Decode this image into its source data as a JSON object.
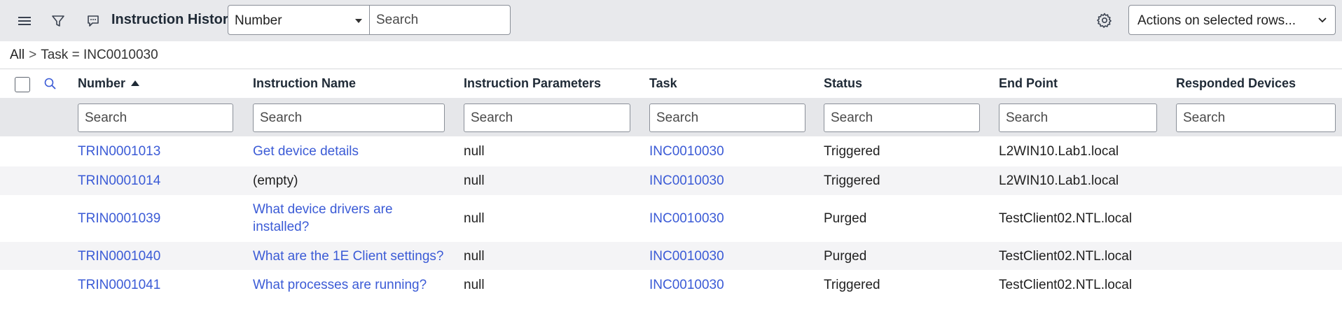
{
  "toolbar": {
    "title": "Instruction History",
    "field_select_value": "Number",
    "search_placeholder": "Search",
    "actions_label": "Actions on selected rows..."
  },
  "breadcrumb": {
    "root": "All",
    "separator": ">",
    "filter": "Task = INC0010030"
  },
  "columns": [
    "Number",
    "Instruction Name",
    "Instruction Parameters",
    "Task",
    "Status",
    "End Point",
    "Responded Devices"
  ],
  "column_search_placeholder": "Search",
  "rows": [
    {
      "number": "TRIN0001013",
      "name": "Get device details",
      "name_line2": "",
      "params": "null",
      "task": "INC0010030",
      "status": "Triggered",
      "endpoint": "L2WIN10.Lab1.local",
      "devices": ""
    },
    {
      "number": "TRIN0001014",
      "name": "(empty)",
      "name_line2": "",
      "params": "null",
      "task": "INC0010030",
      "status": "Triggered",
      "endpoint": "L2WIN10.Lab1.local",
      "devices": ""
    },
    {
      "number": "TRIN0001039",
      "name": "What device drivers are",
      "name_line2": "installed?",
      "params": "null",
      "task": "INC0010030",
      "status": "Purged",
      "endpoint": "TestClient02.NTL.local",
      "devices": ""
    },
    {
      "number": "TRIN0001040",
      "name": "What are the 1E Client settings?",
      "name_line2": "",
      "params": "null",
      "task": "INC0010030",
      "status": "Purged",
      "endpoint": "TestClient02.NTL.local",
      "devices": ""
    },
    {
      "number": "TRIN0001041",
      "name": "What processes are running?",
      "name_line2": "",
      "params": "null",
      "task": "INC0010030",
      "status": "Triggered",
      "endpoint": "TestClient02.NTL.local",
      "devices": ""
    }
  ],
  "colors": {
    "link": "#3b5bd6",
    "toolbar_bg": "#e8e9ec",
    "alt_row_bg": "#f4f4f6"
  }
}
